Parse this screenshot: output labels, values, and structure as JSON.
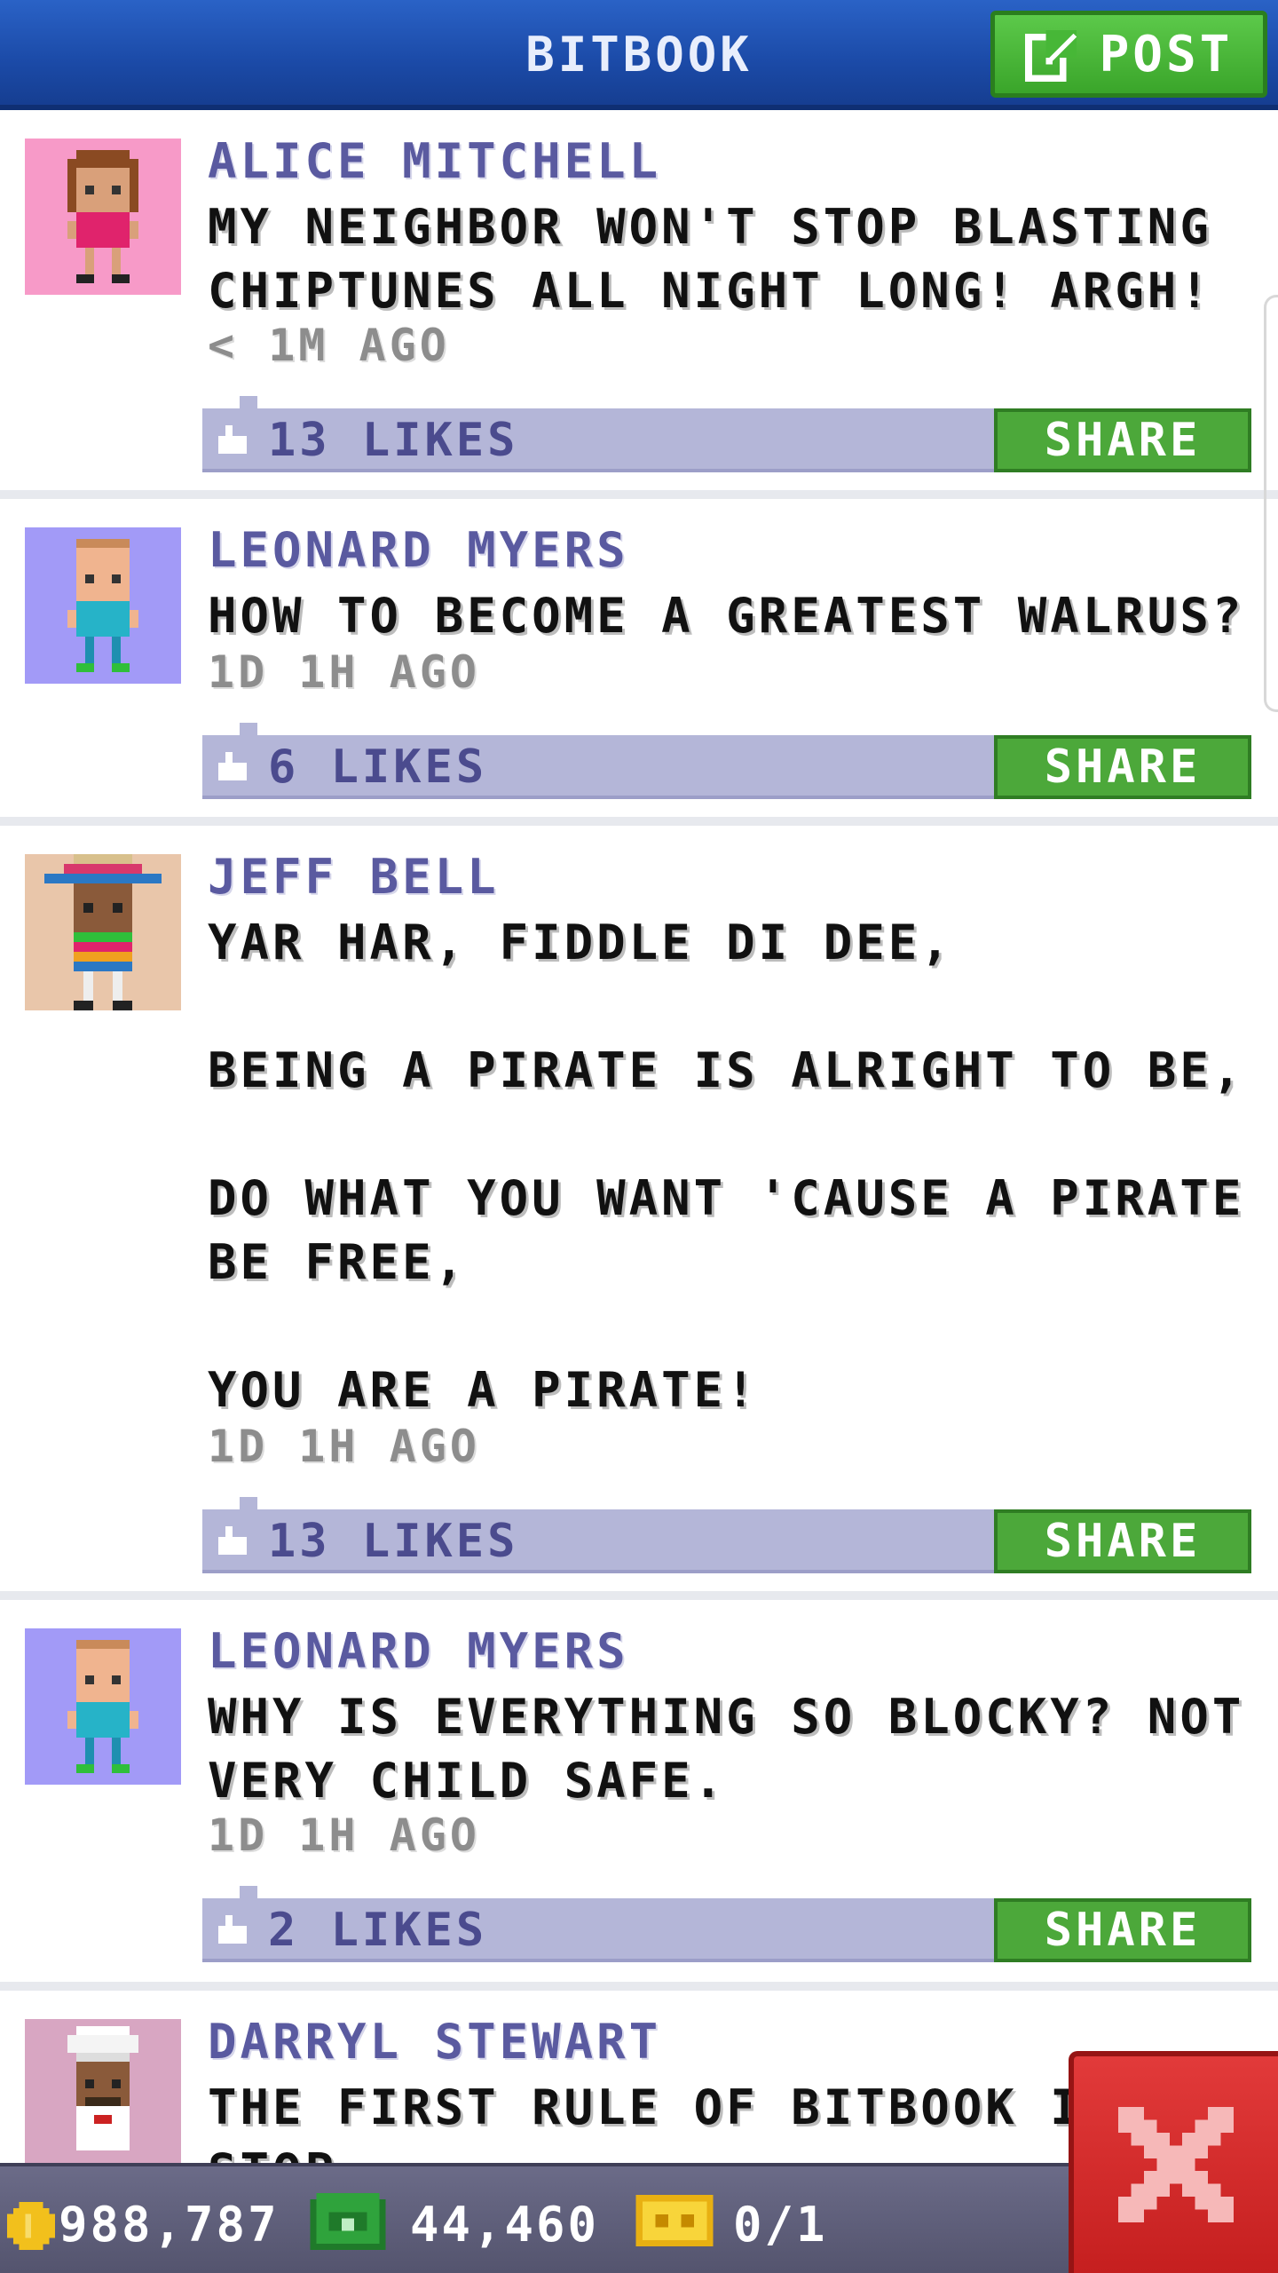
{
  "header": {
    "title": "BITBOOK",
    "post_label": "POST"
  },
  "posts": [
    {
      "author": "ALICE MITCHELL",
      "message": "MY NEIGHBOR WON'T STOP BLASTING\nCHIPTUNES ALL NIGHT LONG! ARGH!",
      "time": "< 1M AGO",
      "likes": "13 LIKES",
      "share": "SHARE"
    },
    {
      "author": "LEONARD MYERS",
      "message": "HOW TO BECOME A GREATEST WALRUS?",
      "time": "1D 1H AGO",
      "likes": "6 LIKES",
      "share": "SHARE"
    },
    {
      "author": "JEFF BELL",
      "message": "YAR HAR, FIDDLE DI DEE,\n\nBEING A PIRATE IS ALRIGHT TO BE,\n\nDO WHAT YOU WANT 'CAUSE A PIRATE\nBE FREE,\n\nYOU ARE A PIRATE!",
      "time": "1D 1H AGO",
      "likes": "13 LIKES",
      "share": "SHARE"
    },
    {
      "author": "LEONARD MYERS",
      "message": "WHY IS EVERYTHING SO BLOCKY? NOT\nVERY CHILD SAFE.",
      "time": "1D 1H AGO",
      "likes": "2 LIKES",
      "share": "SHARE"
    },
    {
      "author": "DARRYL STEWART",
      "message": "THE FIRST RULE OF BITBOOK IS: STOP\nPOSTING STUPID STUFF. NO ONE"
    }
  ],
  "bottombar": {
    "coins": "988,787",
    "bux": "44,460",
    "tickets": "0/1"
  },
  "colors": {
    "header": "#1b4aa7",
    "accent_green": "#4ca83a",
    "like_bar": "#b4b6d8",
    "close_red": "#d42a2a"
  },
  "icons": {
    "post": "edit-icon",
    "like": "thumbs-up-icon",
    "coin": "coin-icon",
    "cash": "cash-icon",
    "ticket": "ticket-icon",
    "close": "close-icon"
  }
}
